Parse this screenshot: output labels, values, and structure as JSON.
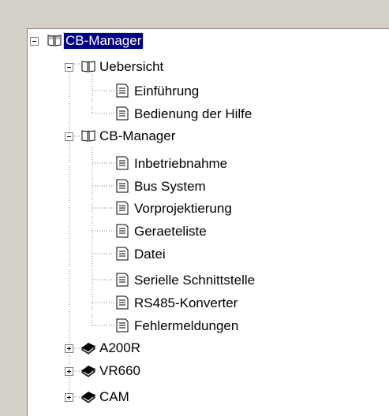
{
  "tree": {
    "root": {
      "label": "CB-Manager",
      "children": [
        {
          "label": "Uebersicht",
          "children": [
            "Einführung",
            "Bedienung der Hilfe"
          ]
        },
        {
          "label": "CB-Manager",
          "children": [
            "Inbetriebnahme",
            "Bus System",
            "Vorprojektierung",
            "Geraeteliste",
            "Datei",
            "Serielle Schnittstelle",
            "RS485-Konverter",
            "Fehlermeldungen"
          ]
        }
      ]
    },
    "collapsed_books": [
      "A200R",
      "VR660",
      "CAM"
    ]
  },
  "icons": {
    "open_book": "open-book-icon",
    "closed_book": "closed-book-icon",
    "page": "page-icon"
  },
  "colors": {
    "selection_bg": "#000080",
    "selection_fg": "#ffffff"
  }
}
